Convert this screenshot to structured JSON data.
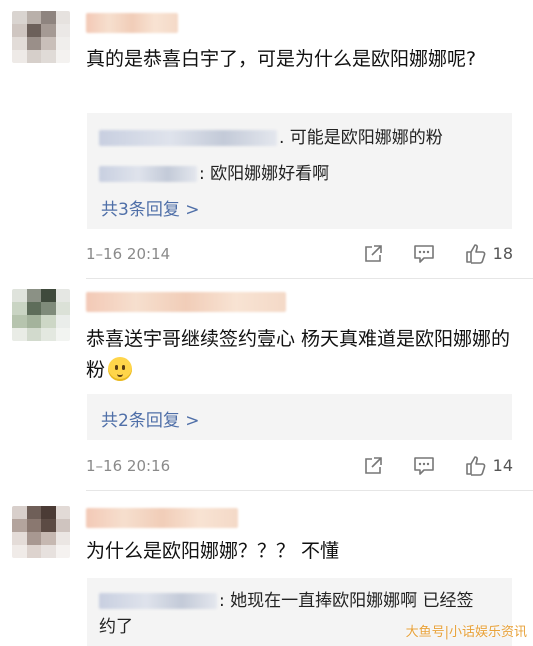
{
  "comments": [
    {
      "text": "真的是恭喜白宇了，可是为什么是欧阳娜娜呢?",
      "replies": [
        {
          "suffix": ". 可能是欧阳娜娜的粉"
        },
        {
          "suffix": ": 欧阳娜娜好看啊"
        }
      ],
      "more_replies": "共3条回复 >",
      "time": "1–16 20:14",
      "likes": "18"
    },
    {
      "text": "恭喜送宇哥继续签约壹心 杨天真难道是欧阳娜娜的粉",
      "emoji": "thinking-face",
      "more_replies": "共2条回复 >",
      "time": "1–16 20:16",
      "likes": "14"
    },
    {
      "text": "为什么是欧阳娜娜？？？ 不懂",
      "replies": [
        {
          "suffix": ": 她现在一直捧欧阳娜娜啊 已经签约了"
        }
      ]
    }
  ],
  "watermark": "大鱼号|小话娱乐资讯",
  "colors": {
    "link": "#4f6fa8",
    "reply_bg": "#f4f4f4",
    "watermark": "#e8a23a"
  }
}
